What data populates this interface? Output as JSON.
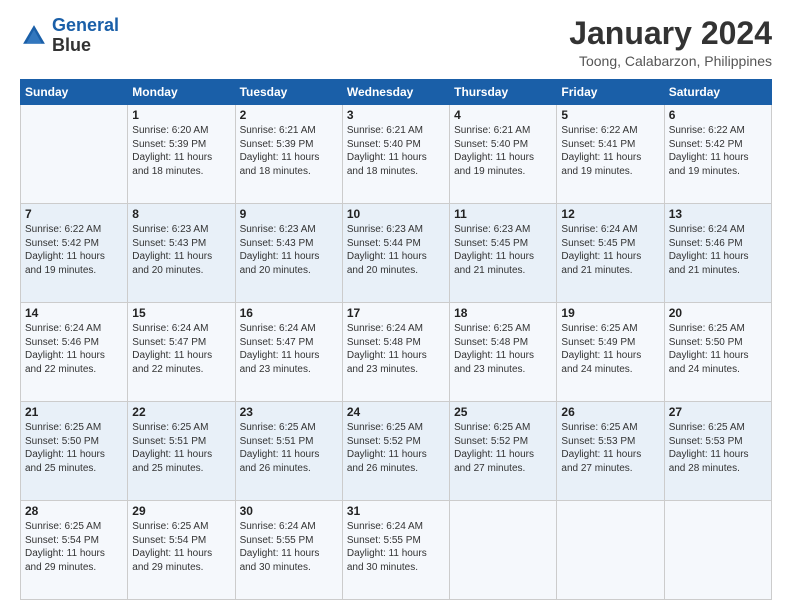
{
  "logo": {
    "line1": "General",
    "line2": "Blue"
  },
  "title": "January 2024",
  "subtitle": "Toong, Calabarzon, Philippines",
  "header_days": [
    "Sunday",
    "Monday",
    "Tuesday",
    "Wednesday",
    "Thursday",
    "Friday",
    "Saturday"
  ],
  "weeks": [
    [
      {
        "day": "",
        "info": ""
      },
      {
        "day": "1",
        "info": "Sunrise: 6:20 AM\nSunset: 5:39 PM\nDaylight: 11 hours\nand 18 minutes."
      },
      {
        "day": "2",
        "info": "Sunrise: 6:21 AM\nSunset: 5:39 PM\nDaylight: 11 hours\nand 18 minutes."
      },
      {
        "day": "3",
        "info": "Sunrise: 6:21 AM\nSunset: 5:40 PM\nDaylight: 11 hours\nand 18 minutes."
      },
      {
        "day": "4",
        "info": "Sunrise: 6:21 AM\nSunset: 5:40 PM\nDaylight: 11 hours\nand 19 minutes."
      },
      {
        "day": "5",
        "info": "Sunrise: 6:22 AM\nSunset: 5:41 PM\nDaylight: 11 hours\nand 19 minutes."
      },
      {
        "day": "6",
        "info": "Sunrise: 6:22 AM\nSunset: 5:42 PM\nDaylight: 11 hours\nand 19 minutes."
      }
    ],
    [
      {
        "day": "7",
        "info": "Sunrise: 6:22 AM\nSunset: 5:42 PM\nDaylight: 11 hours\nand 19 minutes."
      },
      {
        "day": "8",
        "info": "Sunrise: 6:23 AM\nSunset: 5:43 PM\nDaylight: 11 hours\nand 20 minutes."
      },
      {
        "day": "9",
        "info": "Sunrise: 6:23 AM\nSunset: 5:43 PM\nDaylight: 11 hours\nand 20 minutes."
      },
      {
        "day": "10",
        "info": "Sunrise: 6:23 AM\nSunset: 5:44 PM\nDaylight: 11 hours\nand 20 minutes."
      },
      {
        "day": "11",
        "info": "Sunrise: 6:23 AM\nSunset: 5:45 PM\nDaylight: 11 hours\nand 21 minutes."
      },
      {
        "day": "12",
        "info": "Sunrise: 6:24 AM\nSunset: 5:45 PM\nDaylight: 11 hours\nand 21 minutes."
      },
      {
        "day": "13",
        "info": "Sunrise: 6:24 AM\nSunset: 5:46 PM\nDaylight: 11 hours\nand 21 minutes."
      }
    ],
    [
      {
        "day": "14",
        "info": "Sunrise: 6:24 AM\nSunset: 5:46 PM\nDaylight: 11 hours\nand 22 minutes."
      },
      {
        "day": "15",
        "info": "Sunrise: 6:24 AM\nSunset: 5:47 PM\nDaylight: 11 hours\nand 22 minutes."
      },
      {
        "day": "16",
        "info": "Sunrise: 6:24 AM\nSunset: 5:47 PM\nDaylight: 11 hours\nand 23 minutes."
      },
      {
        "day": "17",
        "info": "Sunrise: 6:24 AM\nSunset: 5:48 PM\nDaylight: 11 hours\nand 23 minutes."
      },
      {
        "day": "18",
        "info": "Sunrise: 6:25 AM\nSunset: 5:48 PM\nDaylight: 11 hours\nand 23 minutes."
      },
      {
        "day": "19",
        "info": "Sunrise: 6:25 AM\nSunset: 5:49 PM\nDaylight: 11 hours\nand 24 minutes."
      },
      {
        "day": "20",
        "info": "Sunrise: 6:25 AM\nSunset: 5:50 PM\nDaylight: 11 hours\nand 24 minutes."
      }
    ],
    [
      {
        "day": "21",
        "info": "Sunrise: 6:25 AM\nSunset: 5:50 PM\nDaylight: 11 hours\nand 25 minutes."
      },
      {
        "day": "22",
        "info": "Sunrise: 6:25 AM\nSunset: 5:51 PM\nDaylight: 11 hours\nand 25 minutes."
      },
      {
        "day": "23",
        "info": "Sunrise: 6:25 AM\nSunset: 5:51 PM\nDaylight: 11 hours\nand 26 minutes."
      },
      {
        "day": "24",
        "info": "Sunrise: 6:25 AM\nSunset: 5:52 PM\nDaylight: 11 hours\nand 26 minutes."
      },
      {
        "day": "25",
        "info": "Sunrise: 6:25 AM\nSunset: 5:52 PM\nDaylight: 11 hours\nand 27 minutes."
      },
      {
        "day": "26",
        "info": "Sunrise: 6:25 AM\nSunset: 5:53 PM\nDaylight: 11 hours\nand 27 minutes."
      },
      {
        "day": "27",
        "info": "Sunrise: 6:25 AM\nSunset: 5:53 PM\nDaylight: 11 hours\nand 28 minutes."
      }
    ],
    [
      {
        "day": "28",
        "info": "Sunrise: 6:25 AM\nSunset: 5:54 PM\nDaylight: 11 hours\nand 29 minutes."
      },
      {
        "day": "29",
        "info": "Sunrise: 6:25 AM\nSunset: 5:54 PM\nDaylight: 11 hours\nand 29 minutes."
      },
      {
        "day": "30",
        "info": "Sunrise: 6:24 AM\nSunset: 5:55 PM\nDaylight: 11 hours\nand 30 minutes."
      },
      {
        "day": "31",
        "info": "Sunrise: 6:24 AM\nSunset: 5:55 PM\nDaylight: 11 hours\nand 30 minutes."
      },
      {
        "day": "",
        "info": ""
      },
      {
        "day": "",
        "info": ""
      },
      {
        "day": "",
        "info": ""
      }
    ]
  ]
}
